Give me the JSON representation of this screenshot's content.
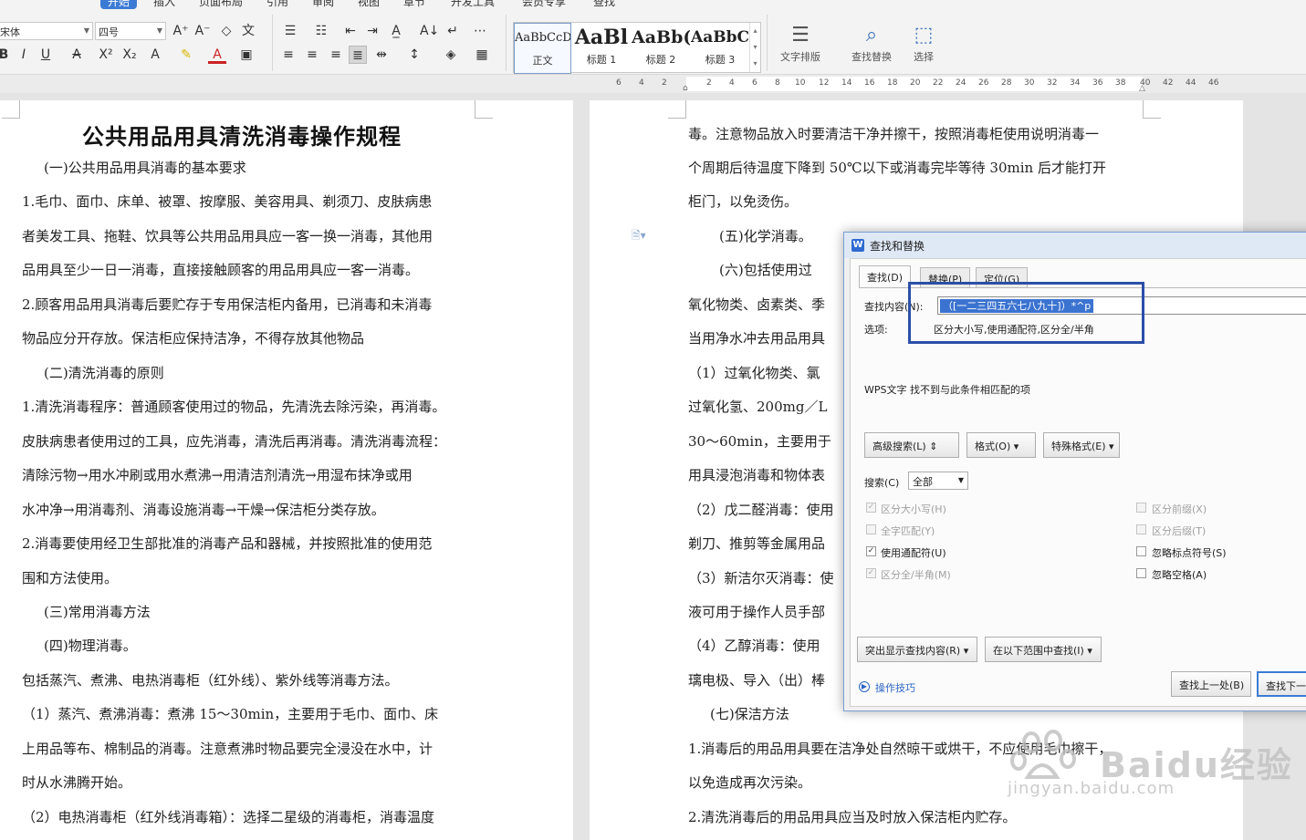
{
  "menu": {
    "items": [
      "开始",
      "插入",
      "页面布局",
      "引用",
      "审阅",
      "视图",
      "章节",
      "开发工具",
      "会员专享",
      "查找"
    ]
  },
  "ribbon": {
    "font_name": "宋体",
    "font_size": "四号",
    "styles": [
      {
        "preview": "AaBbCcDd",
        "label": "正文"
      },
      {
        "preview": "AaBl",
        "label": "标题 1"
      },
      {
        "preview": "AaBb(",
        "label": "标题 2"
      },
      {
        "preview": "AaBbC",
        "label": "标题 3"
      }
    ],
    "text_layout": "文字排版",
    "find_replace": "查找替换",
    "select": "选择"
  },
  "ruler": {
    "numbers": [
      "6",
      "4",
      "2",
      "2",
      "4",
      "6",
      "8",
      "10",
      "12",
      "14",
      "16",
      "18",
      "20",
      "22",
      "24",
      "26",
      "28",
      "30",
      "32",
      "34",
      "36",
      "38",
      "40",
      "42",
      "44",
      "46"
    ]
  },
  "doc_left": {
    "title": "公共用品用具清洗消毒操作规程",
    "lines": [
      "(一)公共用品用具消毒的基本要求",
      "1.毛巾、面巾、床单、被罩、按摩服、美容用具、剃须刀、皮肤病患",
      "者美发工具、拖鞋、饮具等公共用品用具应一客一换一消毒，其他用",
      "品用具至少一日一消毒，直接接触顾客的用品用具应一客一消毒。",
      "2.顾客用品用具消毒后要贮存于专用保洁柜内备用，已消毒和未消毒",
      "物品应分开存放。保洁柜应保持洁净，不得存放其他物品",
      "(二)清洗消毒的原则",
      "1.清洗消毒程序：普通顾客使用过的物品，先清洗去除污染，再消毒。",
      "皮肤病患者使用过的工具，应先消毒，清洗后再消毒。清洗消毒流程：",
      "清除污物→用水冲刷或用水煮沸→用清洁剂清洗→用湿布抹净或用",
      "水冲净→用消毒剂、消毒设施消毒→干燥→保洁柜分类存放。",
      "2.消毒要使用经卫生部批准的消毒产品和器械，并按照批准的使用范",
      "围和方法使用。",
      "(三)常用消毒方法",
      "(四)物理消毒。",
      "包括蒸汽、煮沸、电热消毒柜（红外线）、紫外线等消毒方法。",
      "（1）蒸汽、煮沸消毒：煮沸 15～30min，主要用于毛巾、面巾、床",
      "上用品等布、棉制品的消毒。注意煮沸时物品要完全浸没在水中，计",
      "时从水沸腾开始。",
      "（2）电热消毒柜（红外线消毒箱）：选择二星级的消毒柜，消毒温度"
    ]
  },
  "doc_right": {
    "lines": [
      "毒。注意物品放入时要清洁干净并擦干，按照消毒柜使用说明消毒一",
      "个周期后待温度下降到 50℃以下或消毒完毕等待 30min 后才能打开",
      "柜门，以免烫伤。",
      "(五)化学消毒。",
      "(六)包括使用过",
      "氧化物类、卤素类、季",
      "当用净水冲去用品用具",
      "（1）过氧化物类、氯",
      "过氧化氢、200mg／L",
      "30～60min，主要用于",
      "用具浸泡消毒和物体表",
      "（2）戊二醛消毒：使用",
      "剃刀、推剪等金属用品",
      "（3）新洁尔灭消毒：使",
      "液可用于操作人员手部",
      "（4）乙醇消毒：使用",
      "璃电极、导入（出）棒",
      "(七)保洁方法",
      "1.消毒后的用品用具要在洁净处自然晾干或烘干，不应使用毛巾擦干，",
      "以免造成再次污染。",
      "2.清洗消毒后的用品用具应当及时放入保洁柜内贮存。"
    ]
  },
  "dialog": {
    "title": "查找和替换",
    "tabs": [
      "查找(D)",
      "替换(P)",
      "定位(G)"
    ],
    "find_label": "查找内容(N):",
    "find_value": "（[一二三四五六七八九十]）*^p",
    "options_label": "选项:",
    "options_value": "区分大小写,使用通配符,区分全/半角",
    "message": "WPS文字 找不到与此条件相匹配的项",
    "btn_advanced": "高级搜索(L)",
    "btn_format": "格式(O)",
    "btn_special": "特殊格式(E)",
    "search_label": "搜索(C)",
    "search_value": "全部",
    "checkboxes_left": [
      {
        "label": "区分大小写(H)",
        "checked": true,
        "disabled": true
      },
      {
        "label": "全字匹配(Y)",
        "checked": false,
        "disabled": true
      },
      {
        "label": "使用通配符(U)",
        "checked": true,
        "disabled": false
      },
      {
        "label": "区分全/半角(M)",
        "checked": true,
        "disabled": true
      }
    ],
    "checkboxes_right": [
      {
        "label": "区分前缀(X)",
        "checked": false,
        "disabled": true
      },
      {
        "label": "区分后缀(T)",
        "checked": false,
        "disabled": true
      },
      {
        "label": "忽略标点符号(S)",
        "checked": false,
        "disabled": false
      },
      {
        "label": "忽略空格(A)",
        "checked": false,
        "disabled": false
      }
    ],
    "btn_highlight": "突出显示查找内容(R)",
    "btn_find_in": "在以下范围中查找(I)",
    "tips": "操作技巧",
    "btn_prev": "查找上一处(B)",
    "btn_next": "查找下一处(F)"
  },
  "watermark": {
    "text": "Baidu经验",
    "url": "jingyan.baidu.com"
  }
}
